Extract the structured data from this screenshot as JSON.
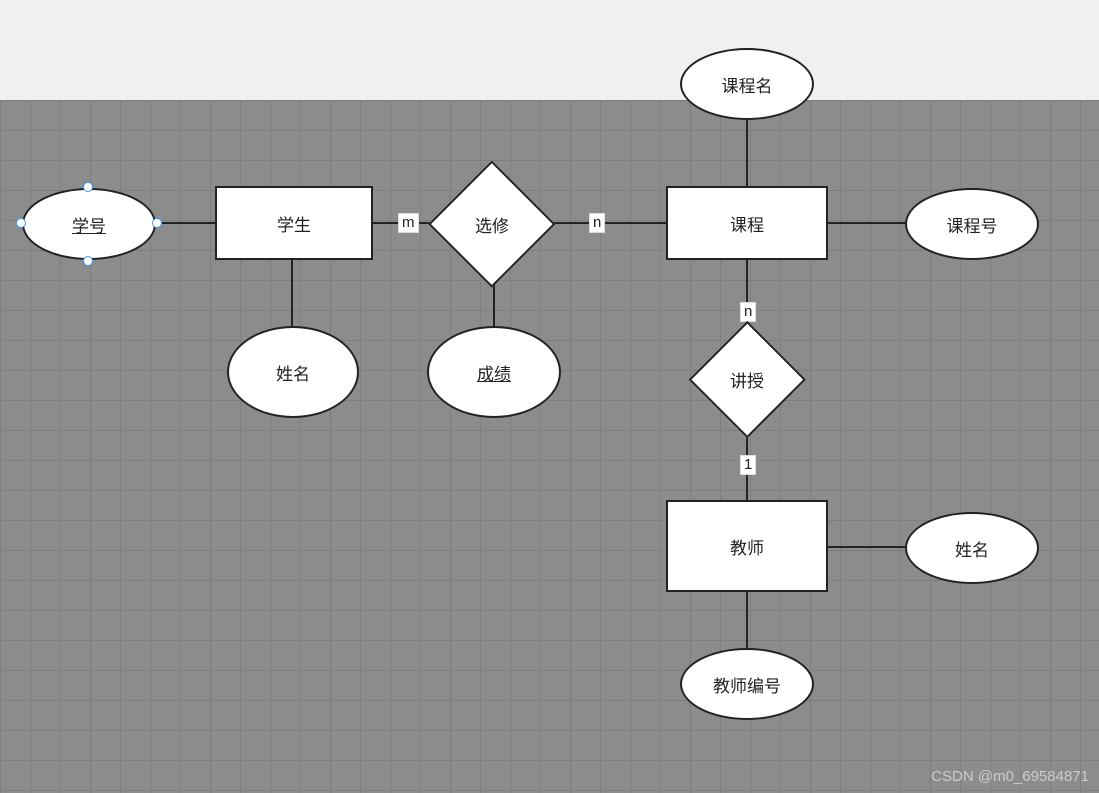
{
  "entities": {
    "student": "学生",
    "course": "课程",
    "teacher": "教师"
  },
  "relationships": {
    "elective": "选修",
    "teach": "讲授"
  },
  "attributes": {
    "student_id": "学号",
    "student_name": "姓名",
    "course_name": "课程名",
    "course_id": "课程号",
    "score": "成绩",
    "teacher_id": "教师编号",
    "teacher_name": "姓名"
  },
  "cardinality": {
    "student_elective": "m",
    "course_elective": "n",
    "course_teach": "n",
    "teacher_teach": "1"
  },
  "watermark": "CSDN @m0_69584871"
}
